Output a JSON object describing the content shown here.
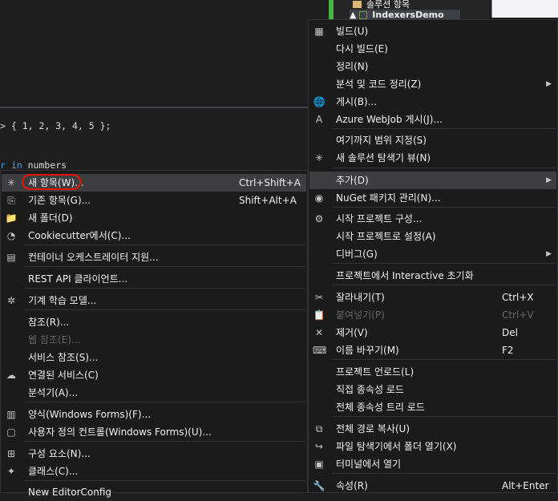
{
  "solution_explorer": {
    "folder_label": "솔루션 항목",
    "project_label": "IndexersDemo"
  },
  "code": {
    "line1": "> { 1, 2, 3, 4, 5 };",
    "line2_kw": "r in",
    "line2_rest": " numbers"
  },
  "right_menu": [
    {
      "icon": "build-icon",
      "glyph": "▦",
      "label": "빌드(U)"
    },
    {
      "label": "다시 빌드(E)"
    },
    {
      "label": "정리(N)"
    },
    {
      "label": "분석 및 코드 정리(Z)",
      "submenu": true
    },
    {
      "icon": "globe-icon",
      "glyph": "🌐",
      "label": "게시(B)..."
    },
    {
      "icon": "azure-icon",
      "glyph": "A",
      "label": "Azure WebJob 게시(J)..."
    },
    {
      "label": "여기까지 범위 지정(S)"
    },
    {
      "icon": "new-view-icon",
      "glyph": "✳",
      "label": "새 솔루션 탐색기 뷰(N)"
    },
    {
      "label": "추가(D)",
      "submenu": true,
      "highlight": true
    },
    {
      "icon": "nuget-icon",
      "glyph": "◉",
      "label": "NuGet 패키지 관리(N)..."
    },
    {
      "icon": "gear-icon",
      "glyph": "⚙",
      "label": "시작 프로젝트 구성..."
    },
    {
      "label": "시작 프로젝트로 설정(A)"
    },
    {
      "label": "디버그(G)",
      "submenu": true
    },
    {
      "label": "프로젝트에서 Interactive 초기화"
    },
    {
      "icon": "cut-icon",
      "glyph": "✂",
      "label": "잘라내기(T)",
      "shortcut": "Ctrl+X"
    },
    {
      "icon": "paste-icon",
      "glyph": "📋",
      "label": "붙여넣기(P)",
      "shortcut": "Ctrl+V",
      "disabled": true
    },
    {
      "icon": "delete-icon",
      "glyph": "✕",
      "label": "제거(V)",
      "shortcut": "Del"
    },
    {
      "icon": "rename-icon",
      "glyph": "⌨",
      "label": "이름 바꾸기(M)",
      "shortcut": "F2"
    },
    {
      "label": "프로젝트 언로드(L)"
    },
    {
      "label": "직접 종속성 로드"
    },
    {
      "label": "전체 종속성 트리 로드"
    },
    {
      "icon": "copy-path-icon",
      "glyph": "⧉",
      "label": "전체 경로 복사(U)"
    },
    {
      "icon": "open-folder-icon",
      "glyph": "↪",
      "label": "파일 탐색기에서 폴더 열기(X)"
    },
    {
      "icon": "terminal-icon",
      "glyph": "▣",
      "label": "터미널에서 열기"
    },
    {
      "icon": "wrench-icon",
      "glyph": "🔧",
      "label": "속성(R)",
      "shortcut": "Alt+Enter"
    }
  ],
  "left_menu": [
    {
      "icon": "new-item-icon",
      "glyph": "✳",
      "label": "새 항목(W)...",
      "shortcut": "Ctrl+Shift+A",
      "highlight": true
    },
    {
      "icon": "existing-item-icon",
      "glyph": "⎘",
      "label": "기존 항목(G)...",
      "shortcut": "Shift+Alt+A"
    },
    {
      "icon": "new-folder-icon",
      "glyph": "📁",
      "label": "새 폴더(D)"
    },
    {
      "icon": "cookiecutter-icon",
      "glyph": "◔",
      "label": "Cookiecutter에서(C)..."
    },
    {
      "icon": "container-icon",
      "glyph": "▤",
      "label": "컨테이너 오케스트레이터 지원..."
    },
    {
      "label": "REST API 클라이언트..."
    },
    {
      "icon": "ml-model-icon",
      "glyph": "✲",
      "label": "기계 학습 모델..."
    },
    {
      "label": "참조(R)..."
    },
    {
      "label": "웹 참조(E)...",
      "disabled": true
    },
    {
      "label": "서비스 참조(S)..."
    },
    {
      "icon": "connected-service-icon",
      "glyph": "☁",
      "label": "연결된 서비스(C)"
    },
    {
      "label": "분석기(A)..."
    },
    {
      "icon": "windows-form-icon",
      "glyph": "▥",
      "label": "양식(Windows Forms)(F)..."
    },
    {
      "icon": "user-control-icon",
      "glyph": "▢",
      "label": "사용자 정의 컨트롤(Windows Forms)(U)..."
    },
    {
      "icon": "component-icon",
      "glyph": "⊞",
      "label": "구성 요소(N)..."
    },
    {
      "icon": "class-icon",
      "glyph": "✦",
      "label": "클래스(C)..."
    },
    {
      "label": "New EditorConfig"
    }
  ],
  "colors": {
    "highlight": "#3e3e40",
    "annotation": "#e51400",
    "menu_bg": "#1b1b1c"
  }
}
